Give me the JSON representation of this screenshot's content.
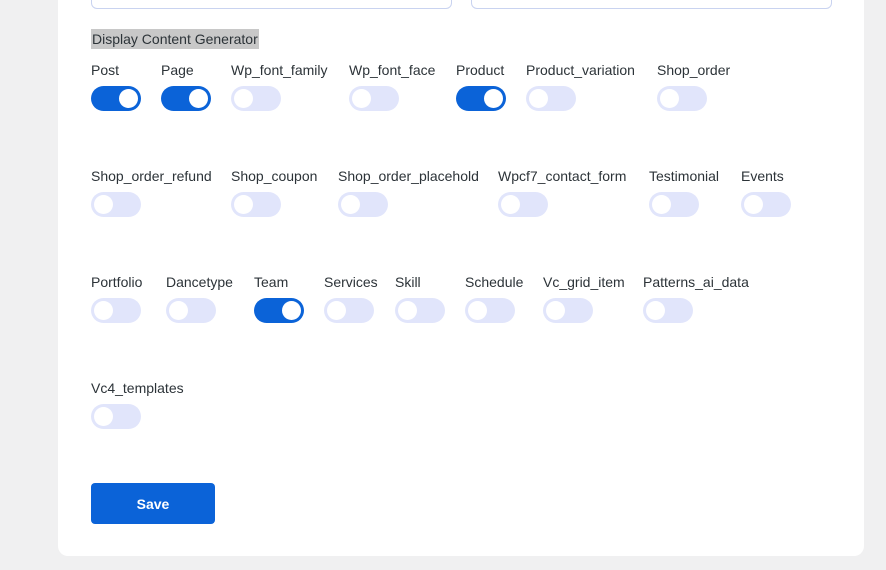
{
  "section": {
    "heading": "Display Content Generator"
  },
  "options": [
    {
      "label": "Post",
      "enabled": true
    },
    {
      "label": "Page",
      "enabled": true
    },
    {
      "label": "Wp_font_family",
      "enabled": false
    },
    {
      "label": "Wp_font_face",
      "enabled": false
    },
    {
      "label": "Product",
      "enabled": true
    },
    {
      "label": "Product_variation",
      "enabled": false
    },
    {
      "label": "Shop_order",
      "enabled": false
    },
    {
      "label": "Shop_order_refund",
      "enabled": false
    },
    {
      "label": "Shop_coupon",
      "enabled": false
    },
    {
      "label": "Shop_order_placehold",
      "enabled": false
    },
    {
      "label": "Wpcf7_contact_form",
      "enabled": false
    },
    {
      "label": "Testimonial",
      "enabled": false
    },
    {
      "label": "Events",
      "enabled": false
    },
    {
      "label": "Portfolio",
      "enabled": false
    },
    {
      "label": "Dancetype",
      "enabled": false
    },
    {
      "label": "Team",
      "enabled": true
    },
    {
      "label": "Services",
      "enabled": false
    },
    {
      "label": "Skill",
      "enabled": false
    },
    {
      "label": "Schedule",
      "enabled": false
    },
    {
      "label": "Vc_grid_item",
      "enabled": false
    },
    {
      "label": "Patterns_ai_data",
      "enabled": false
    },
    {
      "label": "Vc4_templates",
      "enabled": false
    }
  ],
  "save_label": "Save",
  "colors": {
    "toggle_on": "#0b63d8",
    "toggle_off": "#e1e5fb",
    "button": "#0b63d8"
  }
}
